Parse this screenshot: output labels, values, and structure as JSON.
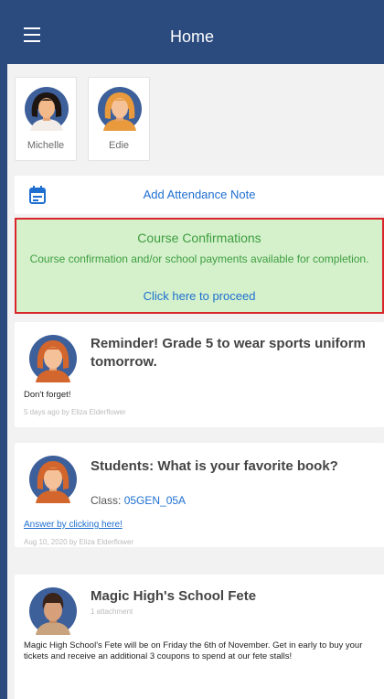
{
  "appbar": {
    "title": "Home",
    "menu_icon": "hamburger-menu-icon"
  },
  "students": [
    {
      "name": "Michelle",
      "avatar": "girl-avatar"
    },
    {
      "name": "Edie",
      "avatar": "girl-avatar"
    }
  ],
  "attendance": {
    "label": "Add Attendance Note",
    "icon": "calendar-icon"
  },
  "course_confirmations": {
    "title": "Course Confirmations",
    "description": "Course confirmation and/or school payments available for completion.",
    "link": "Click here to proceed"
  },
  "feed": [
    {
      "title": "Reminder! Grade 5 to wear sports uniform tomorrow.",
      "body": "Don't forget!",
      "meta": "5 days ago by Eliza Elderflower",
      "avatar": "teacher-avatar"
    },
    {
      "title": "Students: What is your favorite book?",
      "class_label": "Class: ",
      "class_code": "05GEN_05A",
      "answer_link": "Answer by clicking here!",
      "meta": "Aug 10, 2020 by Eliza Elderflower",
      "avatar": "teacher-avatar"
    },
    {
      "title": "Magic High's School Fete",
      "attachment": "1 attachment",
      "body": "Magic High School's Fete will be on Friday the 6th of November. Get in early to buy your tickets and receive an additional 3 coupons to spend at our fete stalls!",
      "avatar": "boy-avatar"
    }
  ],
  "colors": {
    "header": "#2b4a7e",
    "link": "#1e6fd0",
    "confirm_bg": "#d4f1cc",
    "confirm_text": "#3f9d3f",
    "highlight_border": "#d8262b"
  }
}
